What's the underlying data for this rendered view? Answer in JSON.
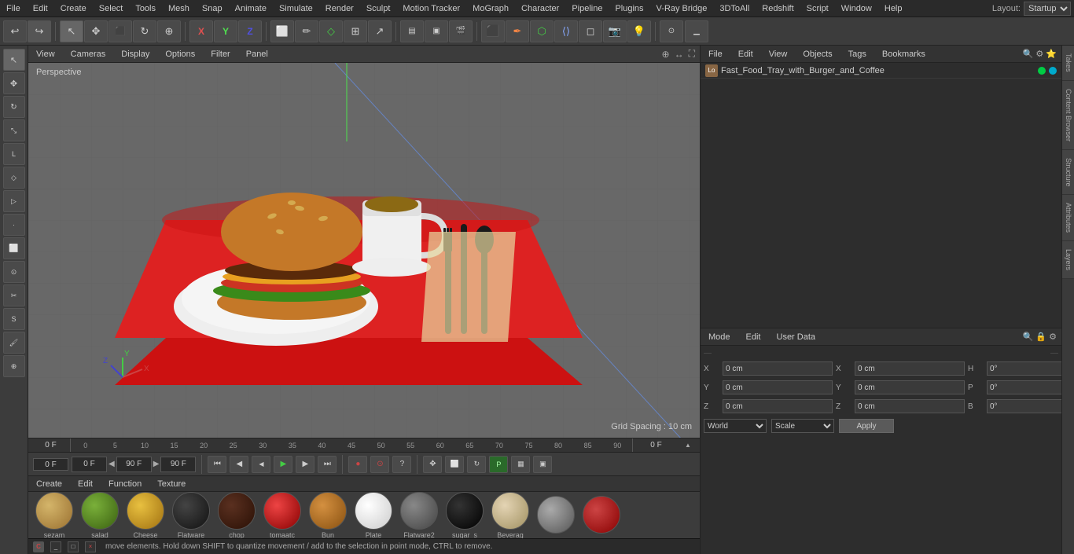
{
  "app": {
    "title": "Cinema 4D",
    "layout": "Startup"
  },
  "menu": {
    "items": [
      "File",
      "Edit",
      "Create",
      "Select",
      "Tools",
      "Mesh",
      "Snap",
      "Animate",
      "Simulate",
      "Render",
      "Sculpt",
      "Motion Tracker",
      "MoGraph",
      "Character",
      "Pipeline",
      "Plugins",
      "V-Ray Bridge",
      "3DToAll",
      "Redshift",
      "Script",
      "Window",
      "Help"
    ],
    "layout_label": "Layout:",
    "layout_value": "Startup"
  },
  "viewport": {
    "perspective_label": "Perspective",
    "grid_spacing": "Grid Spacing : 10 cm",
    "menus": [
      "View",
      "Cameras",
      "Display",
      "Options",
      "Filter",
      "Panel"
    ]
  },
  "objects_panel": {
    "menus": [
      "File",
      "Edit",
      "View",
      "Objects",
      "Tags",
      "Bookmarks"
    ],
    "object_name": "Fast_Food_Tray_with_Burger_and_Coffee",
    "icon_search": "🔍",
    "settings_icons": [
      "⚙",
      "⭐",
      "📋"
    ]
  },
  "attributes_panel": {
    "menus": [
      "Mode",
      "Edit",
      "User Data"
    ],
    "coords": {
      "x_pos": "0 cm",
      "y_pos": "0 cm",
      "z_pos": "0 cm",
      "x_size": "0 cm",
      "y_size": "0 cm",
      "z_size": "0 cm",
      "h_rot": "0°",
      "p_rot": "0°",
      "b_rot": "0°"
    },
    "world_value": "World",
    "scale_value": "Scale",
    "apply_label": "Apply"
  },
  "materials": {
    "header_menus": [
      "Create",
      "Edit",
      "Function",
      "Texture"
    ],
    "items": [
      {
        "name": "sezam",
        "color": "#c4a35a",
        "type": "diffuse"
      },
      {
        "name": "salad",
        "color": "#5a8a2a",
        "type": "diffuse"
      },
      {
        "name": "Cheese",
        "color": "#d4a020",
        "type": "diffuse"
      },
      {
        "name": "Flatware",
        "color": "#1a1a1a",
        "type": "metal"
      },
      {
        "name": "chop",
        "color": "#3a1a1a",
        "type": "diffuse"
      },
      {
        "name": "tomaatc",
        "color": "#cc2222",
        "type": "diffuse"
      },
      {
        "name": "Bun",
        "color": "#c47828",
        "type": "diffuse"
      },
      {
        "name": "Plate",
        "color": "#dddddd",
        "type": "diffuse"
      },
      {
        "name": "Flatware2",
        "color": "#555555",
        "type": "diffuse"
      },
      {
        "name": "sugar_s",
        "color": "#111111",
        "type": "glossy"
      },
      {
        "name": "Beverag",
        "color": "#d4c8a8",
        "type": "diffuse"
      }
    ]
  },
  "timeline": {
    "frame_start": "0 F",
    "frame_end": "90 F",
    "current_frame": "0 F",
    "ticks": [
      "0",
      "5",
      "10",
      "15",
      "20",
      "25",
      "30",
      "35",
      "40",
      "45",
      "50",
      "55",
      "60",
      "65",
      "70",
      "75",
      "80",
      "85",
      "90"
    ]
  },
  "transport": {
    "frame_display_left": "0 F",
    "frame_start_input": "0 F",
    "frame_end_input": "90 F",
    "frame_current": "90 F"
  },
  "status_bar": {
    "message": "move elements. Hold down SHIFT to quantize movement / add to the selection in point mode, CTRL to remove."
  },
  "right_tabs": [
    "Takes",
    "Content Browser",
    "Structure",
    "Attributes",
    "Layers"
  ],
  "icons": {
    "undo": "↩",
    "redo": "↪",
    "move": "✥",
    "scale": "⤡",
    "rotate": "↻",
    "select": "↖",
    "play": "▶",
    "stop": "■",
    "prev": "◀",
    "next": "▶",
    "first": "⏮",
    "last": "⏭",
    "record": "●",
    "search": "🔍"
  }
}
